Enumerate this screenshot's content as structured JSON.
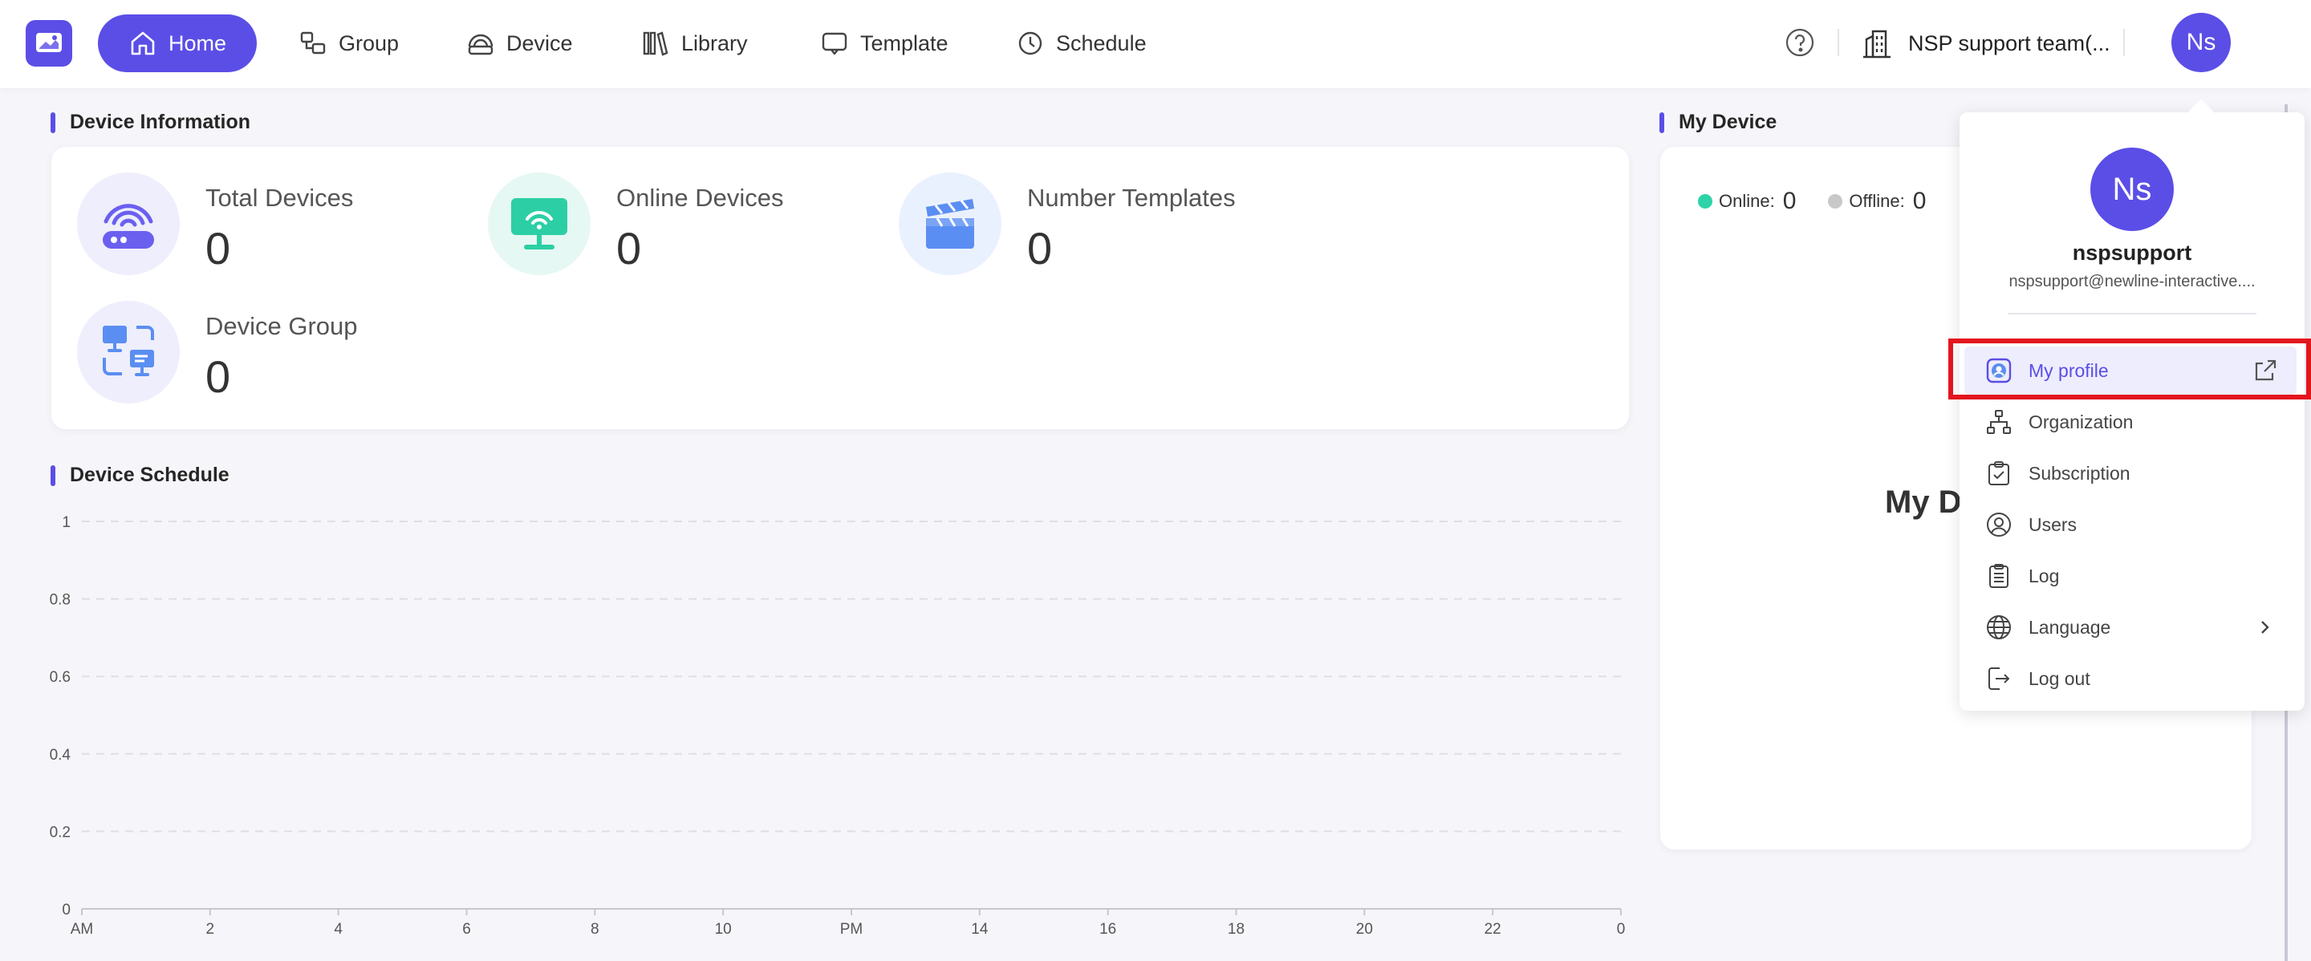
{
  "nav": {
    "items": [
      {
        "label": "Home",
        "icon": "home-icon"
      },
      {
        "label": "Group",
        "icon": "group-icon"
      },
      {
        "label": "Device",
        "icon": "device-icon"
      },
      {
        "label": "Library",
        "icon": "library-icon"
      },
      {
        "label": "Template",
        "icon": "template-icon"
      },
      {
        "label": "Schedule",
        "icon": "clock-icon"
      }
    ],
    "active": "Home",
    "org_name": "NSP support team(...",
    "avatar_initials": "Ns"
  },
  "device_info": {
    "title": "Device Information",
    "stats": [
      {
        "label": "Total Devices",
        "value": "0",
        "icon": "router-icon"
      },
      {
        "label": "Online Devices",
        "value": "0",
        "icon": "monitor-wifi-icon"
      },
      {
        "label": "Number Templates",
        "value": "0",
        "icon": "clapperboard-icon"
      },
      {
        "label": "Device Group",
        "value": "0",
        "icon": "device-group-icon"
      }
    ]
  },
  "schedule": {
    "title": "Device Schedule"
  },
  "chart_data": {
    "type": "line",
    "title": "",
    "xlabel": "",
    "ylabel": "",
    "categories": [
      "AM",
      "2",
      "4",
      "6",
      "8",
      "10",
      "PM",
      "14",
      "16",
      "18",
      "20",
      "22",
      "0"
    ],
    "yticks": [
      "0",
      "0.2",
      "0.4",
      "0.6",
      "0.8",
      "1"
    ],
    "ylim": [
      0,
      1
    ],
    "grid": true,
    "series": []
  },
  "my_device": {
    "title": "My Device",
    "online_label": "Online:",
    "online_value": "0",
    "offline_label": "Offline:",
    "offline_value": "0",
    "big_text": "My De",
    "colors": {
      "online": "#2ed3a7",
      "offline": "#c8c8c8"
    }
  },
  "profile_menu": {
    "initials": "Ns",
    "username": "nspsupport",
    "email": "nspsupport@newline-interactive....",
    "items": [
      {
        "label": "My profile",
        "icon": "profile-icon",
        "trailing": "external-link-icon"
      },
      {
        "label": "Organization",
        "icon": "org-chart-icon"
      },
      {
        "label": "Subscription",
        "icon": "clipboard-check-icon"
      },
      {
        "label": "Users",
        "icon": "user-circle-icon"
      },
      {
        "label": "Log",
        "icon": "log-icon"
      },
      {
        "label": "Language",
        "icon": "globe-icon",
        "trailing": "chevron-right-icon"
      },
      {
        "label": "Log out",
        "icon": "logout-icon"
      }
    ],
    "highlighted": "My profile"
  },
  "theme": {
    "accent": "#5b4ee6",
    "highlight_border": "#e3151f"
  }
}
